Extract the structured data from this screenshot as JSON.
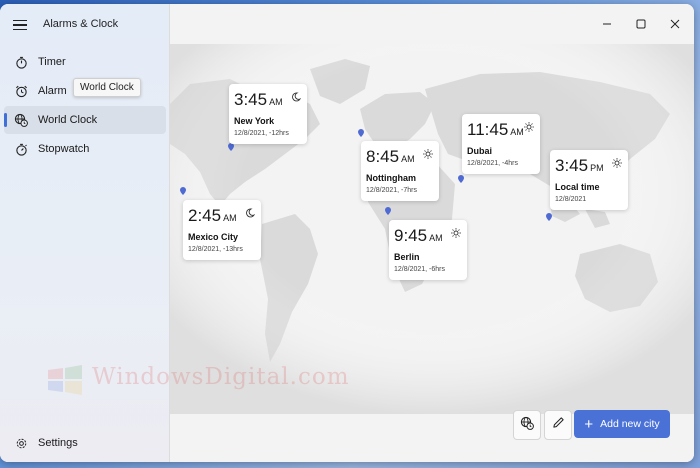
{
  "app": {
    "title": "Alarms & Clock"
  },
  "sidebar": {
    "items": [
      {
        "label": "Timer",
        "icon": "timer-icon"
      },
      {
        "label": "Alarm",
        "icon": "alarm-clock-icon"
      },
      {
        "label": "World Clock",
        "icon": "globe-clock-icon",
        "active": true
      },
      {
        "label": "Stopwatch",
        "icon": "stopwatch-icon"
      }
    ],
    "settings_label": "Settings",
    "tooltip": "World Clock"
  },
  "clocks": [
    {
      "time": "3:45",
      "ampm": "AM",
      "city": "New York",
      "meta": "12/8/2021, -12hrs",
      "condition": "moon-icon"
    },
    {
      "time": "2:45",
      "ampm": "AM",
      "city": "Mexico City",
      "meta": "12/8/2021, -13hrs",
      "condition": "moon-icon"
    },
    {
      "time": "8:45",
      "ampm": "AM",
      "city": "Nottingham",
      "meta": "12/8/2021, -7hrs",
      "condition": "sun-icon"
    },
    {
      "time": "11:45",
      "ampm": "AM",
      "city": "Dubai",
      "meta": "12/8/2021, -4hrs",
      "condition": "sun-icon"
    },
    {
      "time": "9:45",
      "ampm": "AM",
      "city": "Berlin",
      "meta": "12/8/2021, -6hrs",
      "condition": "sun-icon"
    },
    {
      "time": "3:45",
      "ampm": "PM",
      "city": "Local time",
      "meta": "12/8/2021",
      "condition": "sun-icon"
    }
  ],
  "actions": {
    "add_city_label": "Add new city"
  },
  "watermark": "WindowsDigital.com",
  "colors": {
    "accent": "#4a71d6",
    "sidebar_active_indicator": "#3f6fd8",
    "map_land": "#dadada"
  }
}
